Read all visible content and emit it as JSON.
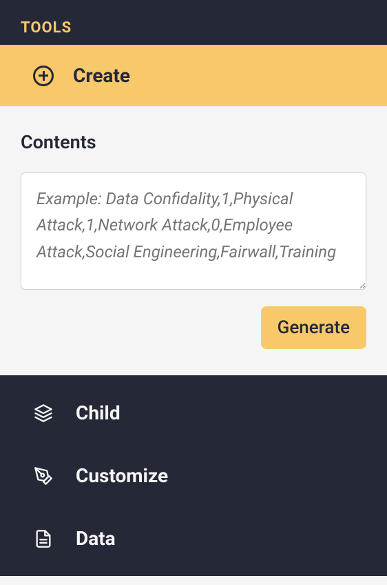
{
  "header": {
    "tools_label": "TOOLS"
  },
  "create": {
    "label": "Create"
  },
  "content": {
    "contents_label": "Contents",
    "placeholder": "Example: Data Confidality,1,Physical Attack,1,Network Attack,0,Employee Attack,Social Engineering,Fairwall,Training",
    "generate_label": "Generate"
  },
  "menu": {
    "items": [
      {
        "label": "Child"
      },
      {
        "label": "Customize"
      },
      {
        "label": "Data"
      }
    ]
  }
}
